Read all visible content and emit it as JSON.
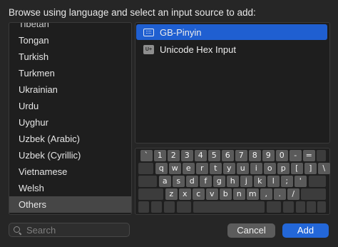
{
  "heading": "Browse using language and select an input source to add:",
  "languages": [
    {
      "label": "Tibetan",
      "state": "partial"
    },
    {
      "label": "Tongan"
    },
    {
      "label": "Turkish"
    },
    {
      "label": "Turkmen"
    },
    {
      "label": "Ukrainian"
    },
    {
      "label": "Urdu"
    },
    {
      "label": "Uyghur"
    },
    {
      "label": "Uzbek (Arabic)"
    },
    {
      "label": "Uzbek (Cyrillic)"
    },
    {
      "label": "Vietnamese"
    },
    {
      "label": "Welsh"
    },
    {
      "label": "Others",
      "selected": true
    }
  ],
  "sources": [
    {
      "label": "GB-Pinyin",
      "icon": "keyboard-icon",
      "selected": true
    },
    {
      "label": "Unicode Hex Input",
      "icon": "unicode-hex-icon",
      "icon_text": "U+"
    }
  ],
  "keyboard": {
    "rows": [
      [
        "`",
        "1",
        "2",
        "3",
        "4",
        "5",
        "6",
        "7",
        "8",
        "9",
        "0",
        "-",
        "="
      ],
      [
        "q",
        "w",
        "e",
        "r",
        "t",
        "y",
        "u",
        "i",
        "o",
        "p",
        "[",
        "]",
        "\\"
      ],
      [
        "a",
        "s",
        "d",
        "f",
        "g",
        "h",
        "j",
        "k",
        "l",
        ";",
        "'"
      ],
      [
        "z",
        "x",
        "c",
        "v",
        "b",
        "n",
        "m",
        ",",
        ".",
        "/"
      ]
    ]
  },
  "search": {
    "placeholder": "Search",
    "value": ""
  },
  "buttons": {
    "cancel": "Cancel",
    "add": "Add"
  },
  "colors": {
    "background": "#262626",
    "list_background": "#1e1e1e",
    "selected_source": "#1f5fd1",
    "selected_language": "#464646",
    "key": "#5a5a5a",
    "add_button": "#2367d8",
    "cancel_button": "#5c5c5c"
  }
}
